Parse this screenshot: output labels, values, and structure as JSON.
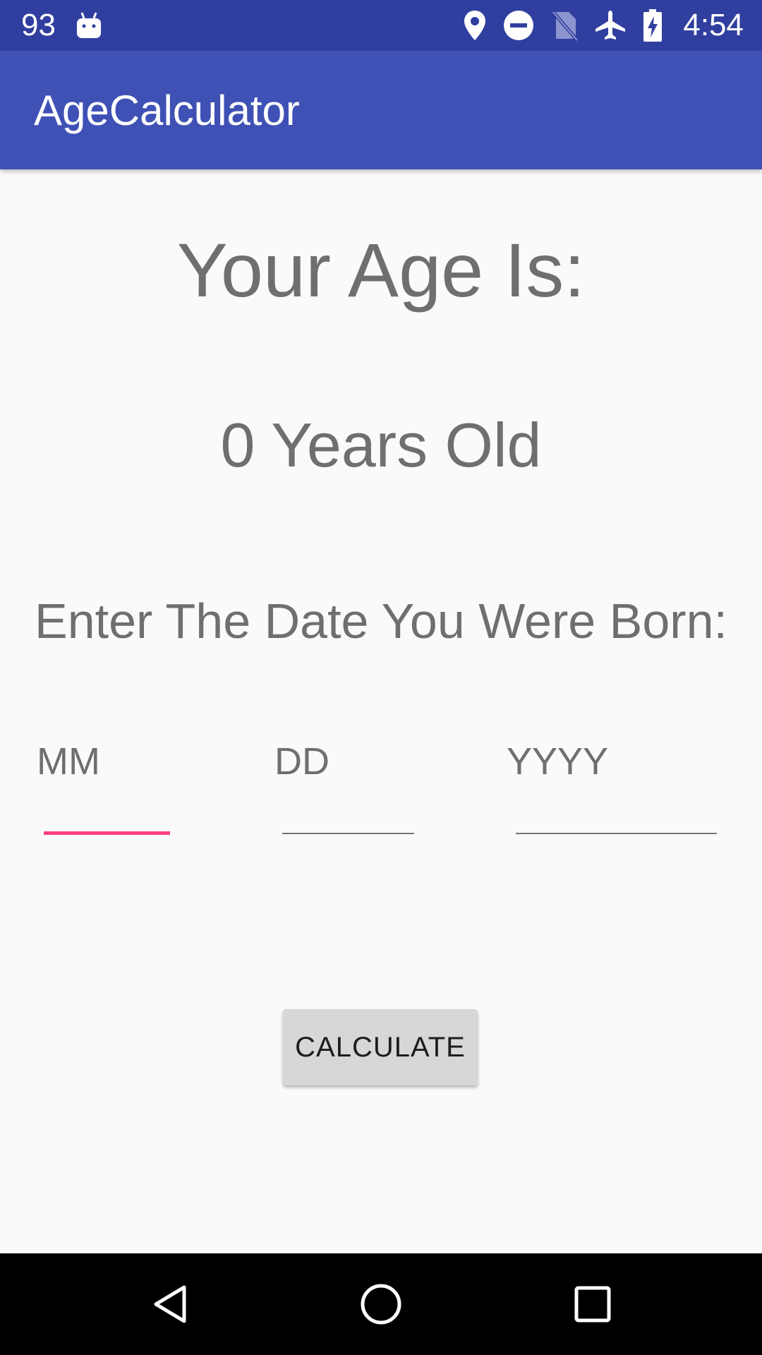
{
  "status_bar": {
    "left_text": "93",
    "time": "4:54",
    "icons": [
      "android-icon",
      "location-icon",
      "do-not-disturb-icon",
      "no-sim-icon",
      "airplane-icon",
      "battery-charging-icon"
    ]
  },
  "app_bar": {
    "title": "AgeCalculator"
  },
  "main": {
    "age_title": "Your Age Is:",
    "age_value": "0 Years Old",
    "prompt": "Enter The Date You Were Born:",
    "fields": [
      {
        "label": "MM",
        "value": ""
      },
      {
        "label": "DD",
        "value": ""
      },
      {
        "label": "YYYY",
        "value": ""
      }
    ],
    "button_label": "CALCULATE"
  },
  "nav_bar": {
    "icons": [
      "back-icon",
      "home-icon",
      "recents-icon"
    ]
  },
  "colors": {
    "status_bar": "#303f9f",
    "app_bar": "#3f51b5",
    "accent": "#ff4081",
    "text_secondary": "#6f6f6f",
    "button": "#d6d7d7"
  }
}
